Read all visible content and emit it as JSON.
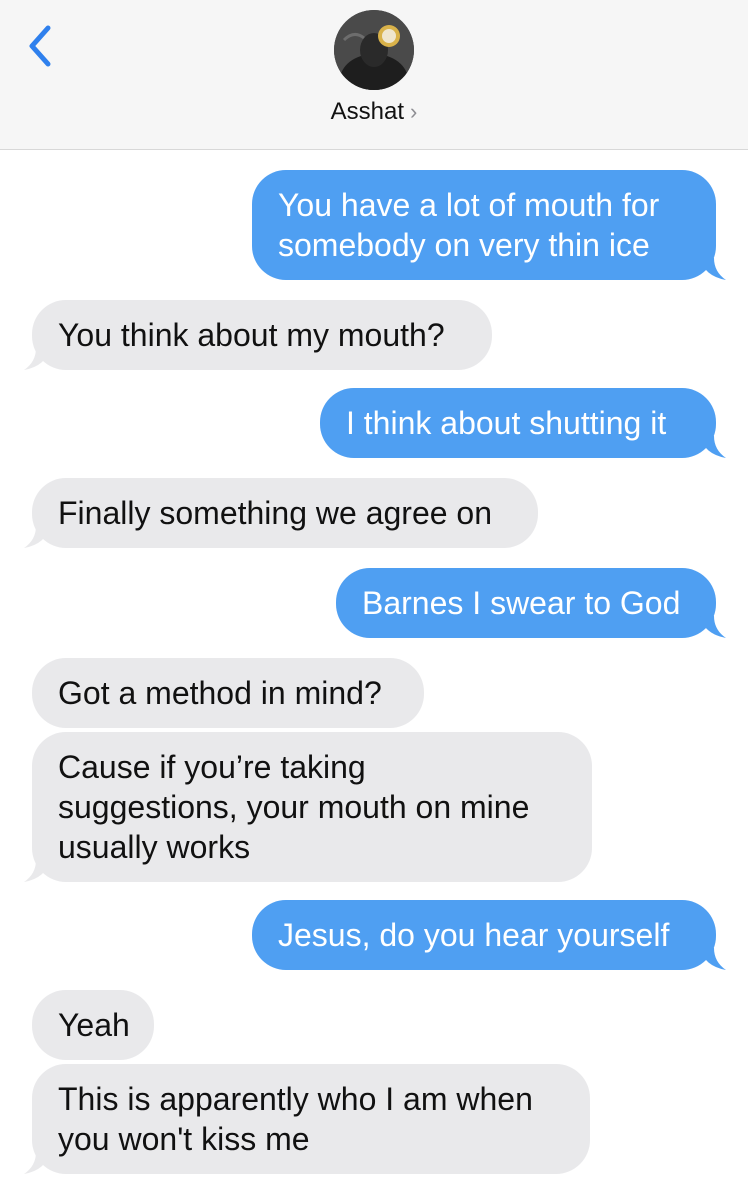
{
  "header": {
    "contact_name": "Asshat",
    "name_chevron": "›",
    "back_icon": "chevron-left-icon",
    "avatar_icon": "contact-avatar"
  },
  "colors": {
    "sent_bubble": "#4f9ff2",
    "received_bubble": "#e9e9eb",
    "accent": "#2f80ed"
  },
  "messages": [
    {
      "direction": "sent",
      "text": "You have a lot of mouth for\nsomebody on very thin ice"
    },
    {
      "direction": "received",
      "text": "You think about my mouth?"
    },
    {
      "direction": "sent",
      "text": "I think about shutting it"
    },
    {
      "direction": "received",
      "text": "Finally something we agree on"
    },
    {
      "direction": "sent",
      "text": "Barnes I swear to God"
    },
    {
      "direction": "received",
      "text": "Got a method in mind?"
    },
    {
      "direction": "received",
      "text": "Cause if you’re taking\nsuggestions, your mouth on mine\nusually works"
    },
    {
      "direction": "sent",
      "text": "Jesus, do you hear yourself"
    },
    {
      "direction": "received",
      "text": "Yeah"
    },
    {
      "direction": "received",
      "text": "This is apparently who I am when\nyou won't kiss me"
    }
  ]
}
